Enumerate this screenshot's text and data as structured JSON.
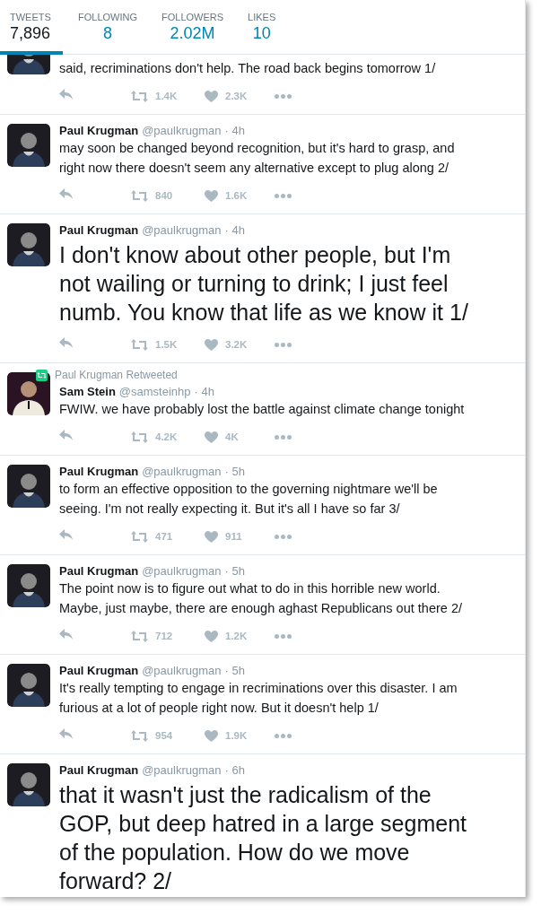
{
  "stats": [
    {
      "label": "TWEETS",
      "value": "7,896",
      "selected": true
    },
    {
      "label": "FOLLOWING",
      "value": "8",
      "selected": false
    },
    {
      "label": "FOLLOWERS",
      "value": "2.02M",
      "selected": false
    },
    {
      "label": "LIKES",
      "value": "10",
      "selected": false
    }
  ],
  "tweets": [
    {
      "kind": "cut",
      "text": "said, recriminations don't help. The road back begins tomorrow 1/",
      "retweets": "1.4K",
      "likes": "2.3K"
    },
    {
      "kind": "normal",
      "name": "Paul Krugman",
      "handle": "@paulkrugman",
      "time": "· 4h",
      "text": "may soon be changed beyond recognition, but it's hard to grasp, and right now there doesn't seem any alternative except to plug along 2/",
      "retweets": "840",
      "likes": "1.6K"
    },
    {
      "kind": "large",
      "name": "Paul Krugman",
      "handle": "@paulkrugman",
      "time": "· 4h",
      "text": "I don't know about other people, but I'm not wailing or turning to drink; I just feel numb. You know that life as we know it 1/",
      "retweets": "1.5K",
      "likes": "3.2K"
    },
    {
      "kind": "normal",
      "retweeted_by": "Paul Krugman Retweeted",
      "name": "Sam Stein",
      "handle": "@samsteinhp",
      "time": "· 4h",
      "text": "FWIW. we have probably lost the battle against climate change tonight",
      "retweets": "4.2K",
      "likes": "4K"
    },
    {
      "kind": "normal",
      "name": "Paul Krugman",
      "handle": "@paulkrugman",
      "time": "· 5h",
      "text": "to form an effective opposition to the governing nightmare we'll be seeing. I'm not really expecting it. But it's all I have so far 3/",
      "retweets": "471",
      "likes": "911"
    },
    {
      "kind": "normal",
      "name": "Paul Krugman",
      "handle": "@paulkrugman",
      "time": "· 5h",
      "text": "The point now is to figure out what to do in this horrible new world. Maybe, just maybe, there are enough aghast Republicans out there 2/",
      "retweets": "712",
      "likes": "1.2K"
    },
    {
      "kind": "normal",
      "name": "Paul Krugman",
      "handle": "@paulkrugman",
      "time": "· 5h",
      "text": "It's really tempting to engage in recriminations over this disaster. I am furious at a lot of people right now. But it doesn't help 1/",
      "retweets": "954",
      "likes": "1.9K"
    },
    {
      "kind": "large",
      "name": "Paul Krugman",
      "handle": "@paulkrugman",
      "time": "· 6h",
      "text": "that it wasn't just the radicalism of the GOP, but deep hatred in a large segment of the population. How do we move forward? 2/"
    }
  ]
}
